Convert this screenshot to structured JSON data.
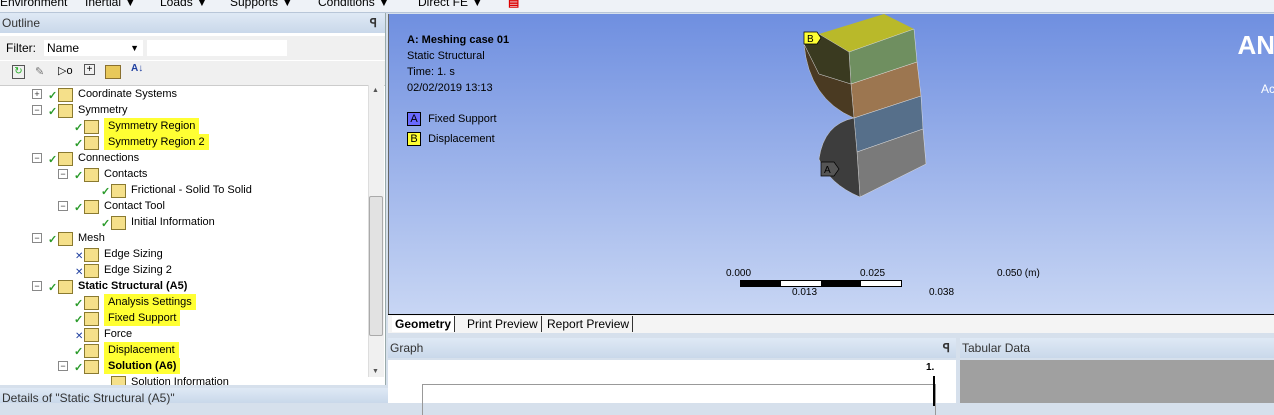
{
  "toolbar": {
    "items": [
      "Environment",
      "Inertial ▼",
      "Loads ▼",
      "Supports ▼",
      "Conditions ▼",
      "Direct FE ▼"
    ]
  },
  "outline": {
    "title": "Outline",
    "filter_label": "Filter:",
    "filter_value": "Name",
    "filter_text": "",
    "tree": [
      {
        "label": "Coordinate Systems",
        "level": 0,
        "expand": "+",
        "status": "check",
        "hl": false,
        "bold": false
      },
      {
        "label": "Symmetry",
        "level": 0,
        "expand": "-",
        "status": "check",
        "hl": false,
        "bold": false
      },
      {
        "label": "Symmetry Region",
        "level": 1,
        "expand": "",
        "status": "check",
        "hl": true,
        "bold": false
      },
      {
        "label": "Symmetry Region 2",
        "level": 1,
        "expand": "",
        "status": "check",
        "hl": true,
        "bold": false
      },
      {
        "label": "Connections",
        "level": 0,
        "expand": "-",
        "status": "check",
        "hl": false,
        "bold": false
      },
      {
        "label": "Contacts",
        "level": 1,
        "expand": "-",
        "status": "check",
        "hl": false,
        "bold": false
      },
      {
        "label": "Frictional - Solid To Solid",
        "level": 2,
        "expand": "",
        "status": "check",
        "hl": false,
        "bold": false
      },
      {
        "label": "Contact Tool",
        "level": 1,
        "expand": "-",
        "status": "check",
        "hl": false,
        "bold": false
      },
      {
        "label": "Initial Information",
        "level": 2,
        "expand": "",
        "status": "check",
        "hl": false,
        "bold": false
      },
      {
        "label": "Mesh",
        "level": 0,
        "expand": "-",
        "status": "check",
        "hl": false,
        "bold": false
      },
      {
        "label": "Edge Sizing",
        "level": 1,
        "expand": "",
        "status": "x",
        "hl": false,
        "bold": false
      },
      {
        "label": "Edge Sizing 2",
        "level": 1,
        "expand": "",
        "status": "x",
        "hl": false,
        "bold": false
      },
      {
        "label": "Static Structural (A5)",
        "level": 0,
        "expand": "-",
        "status": "check",
        "hl": false,
        "bold": true
      },
      {
        "label": "Analysis Settings",
        "level": 1,
        "expand": "",
        "status": "check",
        "hl": true,
        "bold": false
      },
      {
        "label": "Fixed Support",
        "level": 1,
        "expand": "",
        "status": "check",
        "hl": true,
        "bold": false
      },
      {
        "label": "Force",
        "level": 1,
        "expand": "",
        "status": "x",
        "hl": false,
        "bold": false
      },
      {
        "label": "Displacement",
        "level": 1,
        "expand": "",
        "status": "check",
        "hl": true,
        "bold": false
      },
      {
        "label": "Solution (A6)",
        "level": 1,
        "expand": "-",
        "status": "check",
        "hl": true,
        "bold": true
      },
      {
        "label": "Solution Information",
        "level": 2,
        "expand": "",
        "status": "",
        "hl": false,
        "bold": false
      }
    ]
  },
  "details": {
    "title": "Details of \"Static Structural (A5)\""
  },
  "viewport": {
    "title": "A: Meshing case 01",
    "subtitle": "Static Structural",
    "time": "Time: 1. s",
    "date": "02/02/2019 13:13",
    "legend": [
      {
        "key": "A",
        "label": "Fixed Support",
        "color": "#6a6aff"
      },
      {
        "key": "B",
        "label": "Displacement",
        "color": "#ffff33"
      }
    ],
    "logo": "AN",
    "logo_sub": "Ac",
    "scale": {
      "top": [
        "0.000",
        "0.025",
        "0.050 (m)"
      ],
      "bottom": [
        "0.013",
        "0.038"
      ]
    }
  },
  "tabs": [
    "Geometry",
    "Print Preview",
    "Report Preview"
  ],
  "graph": {
    "title": "Graph",
    "axis_label": "1."
  },
  "tabular": {
    "title": "Tabular Data"
  }
}
